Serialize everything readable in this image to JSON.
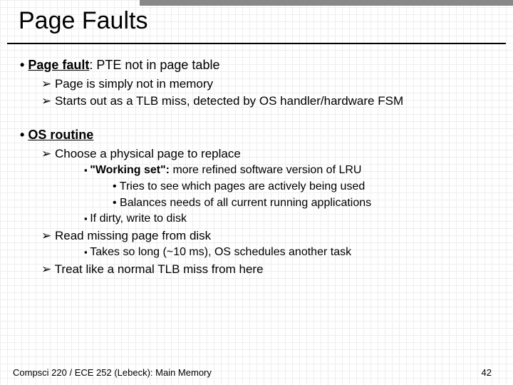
{
  "title": "Page Faults",
  "section1": {
    "label": "Page fault",
    "text": ": PTE not in page table",
    "sub1": "Page is simply not in memory",
    "sub2": "Starts out as a TLB miss, detected by OS handler/hardware FSM"
  },
  "section2": {
    "label": "OS routine",
    "s1": "Choose a physical page to replace",
    "s1a_label": "\"Working set\":",
    "s1a_text": " more refined software version of LRU",
    "s1a1": "Tries to see which pages are actively being used",
    "s1a2": "Balances needs of all current running applications",
    "s1b": "If dirty, write to disk",
    "s2": "Read missing page from disk",
    "s2a": "Takes so long (~10 ms), OS schedules another task",
    "s3": "Treat like a normal TLB miss from here"
  },
  "footer": {
    "left": "Compsci 220 / ECE 252 (Lebeck): Main Memory",
    "right": "42"
  }
}
